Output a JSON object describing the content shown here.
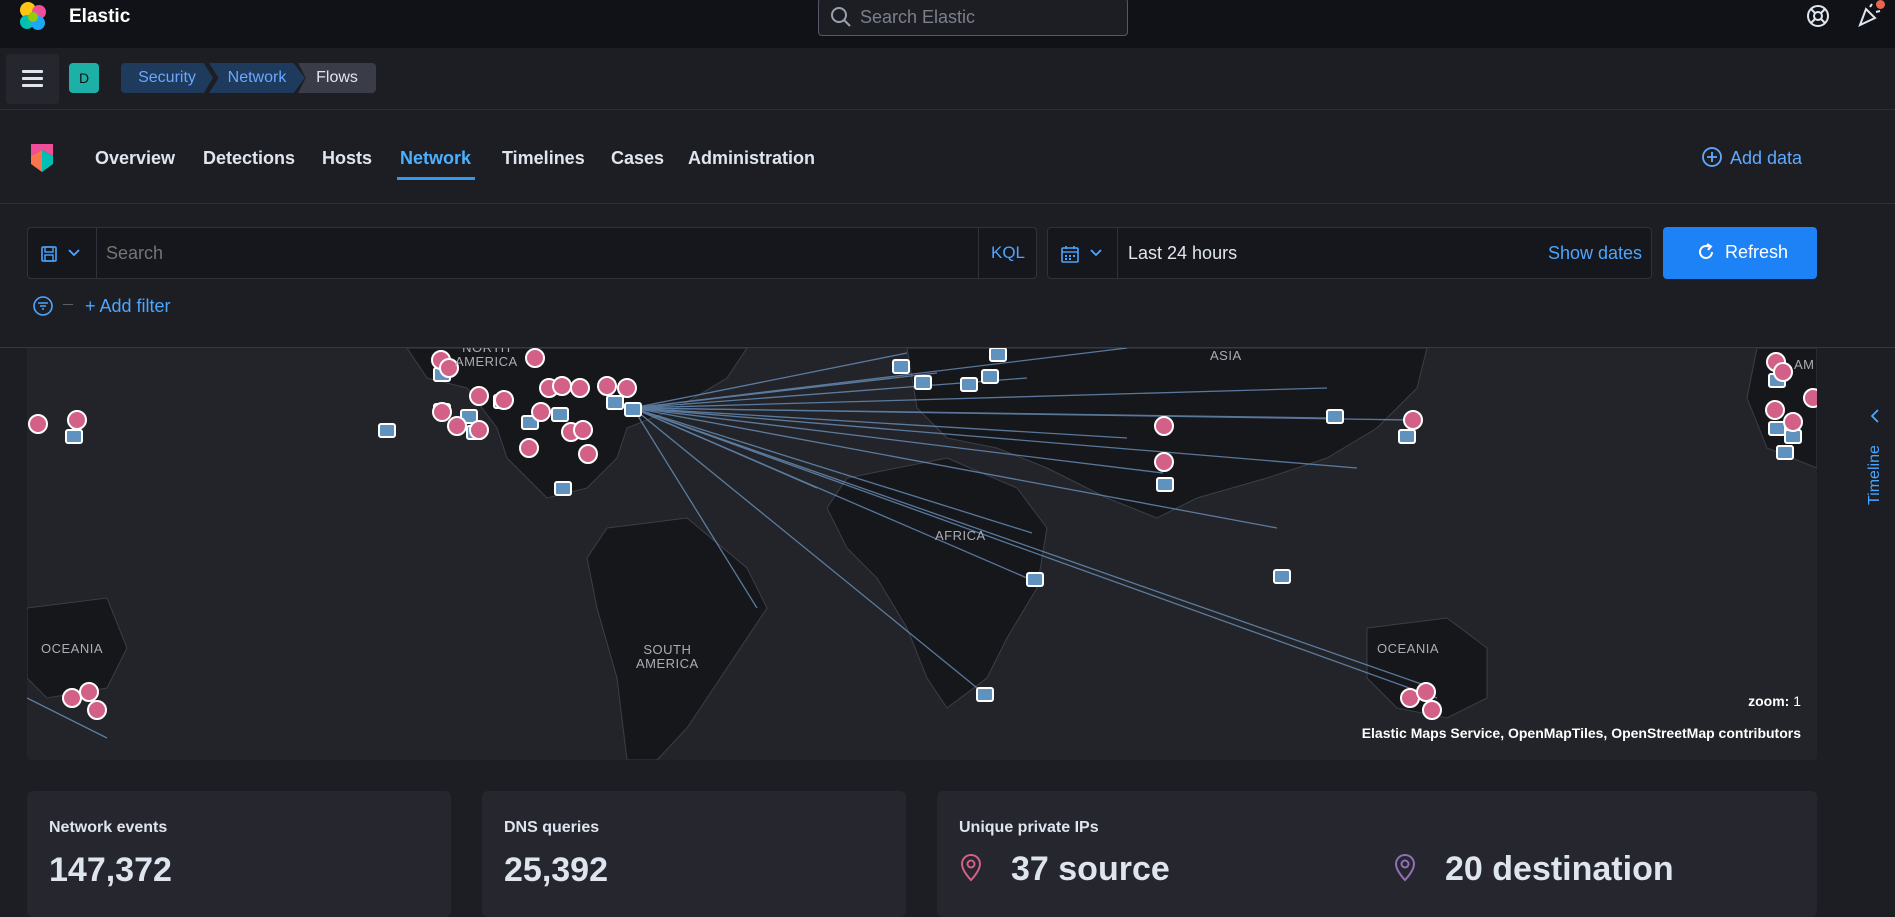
{
  "header": {
    "brand": "Elastic",
    "search_placeholder": "Search Elastic",
    "icons": [
      "elastic-logo-icon",
      "search-icon",
      "help-icon",
      "newsfeed-icon"
    ]
  },
  "subheader": {
    "space_initial": "D",
    "breadcrumbs": [
      "Security",
      "Network",
      "Flows"
    ]
  },
  "nav": {
    "tabs": [
      "Overview",
      "Detections",
      "Hosts",
      "Network",
      "Timelines",
      "Cases",
      "Administration"
    ],
    "active_tab": "Network",
    "add_data_label": "Add data"
  },
  "query": {
    "search_placeholder": "Search",
    "language": "KQL",
    "date_range": "Last 24 hours",
    "show_dates_label": "Show dates",
    "refresh_label": "Refresh",
    "add_filter_label": "+ Add filter"
  },
  "map": {
    "labels": {
      "north_america": "NORTH\nAMERICA",
      "asia": "ASIA",
      "africa": "AFRICA",
      "south_america": "SOUTH\nAMERICA",
      "oceania_left": "OCEANIA",
      "oceania_right": "OCEANIA",
      "am_partial": "AM"
    },
    "zoom_label": "zoom:",
    "zoom_value": "1",
    "attribution": "Elastic Maps Service, OpenMapTiles, OpenStreetMap contributors"
  },
  "timeline_label": "Timeline",
  "stats": {
    "network_events": {
      "label": "Network events",
      "value": "147,372"
    },
    "dns_queries": {
      "label": "DNS queries",
      "value": "25,392"
    },
    "unique_private_ips": {
      "label": "Unique private IPs",
      "source": "37 source",
      "destination": "20 destination"
    }
  },
  "colors": {
    "accent": "#1d82f5",
    "link": "#4ba6ff",
    "source_marker": "#d36086",
    "destination_marker": "#6092c0",
    "destination_pin": "#9170b8"
  }
}
